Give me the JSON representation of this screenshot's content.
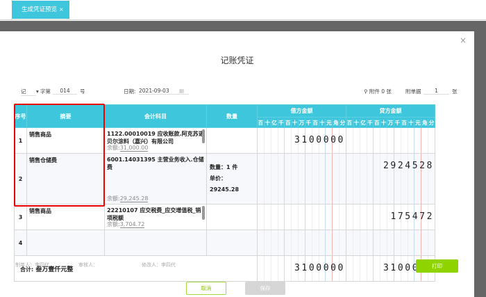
{
  "tab": {
    "label": "生成凭证预览",
    "close": "×"
  },
  "title": "记账凭证",
  "close": "×",
  "meta": {
    "type": "记",
    "zi": "字第",
    "number": "014",
    "hao": "号",
    "date_label": "日期:",
    "date": "2021-09-03",
    "attachment": "附件 0 张",
    "doc_label": "附单据",
    "doc_count": "1",
    "zhang": "张"
  },
  "headers": {
    "seq": "序号",
    "summary": "摘要",
    "account": "会计科目",
    "qty": "数量",
    "debit": "借方金额",
    "credit": "贷方金额",
    "units": [
      "百",
      "十",
      "亿",
      "千",
      "百",
      "十",
      "万",
      "千",
      "百",
      "十",
      "元",
      "角",
      "分"
    ]
  },
  "rows": [
    {
      "seq": "1",
      "summary": "销售商品",
      "account": "1122.00010019 应收账款.阿克苏诺贝尔涂料（嘉兴）有限公司",
      "bal_label": "余额:",
      "balance": "31,000.00",
      "qty": "",
      "price": "",
      "debit": "3100000",
      "credit": ""
    },
    {
      "seq": "2",
      "summary": "销售仓储费",
      "account": "6001.14031395 主营业务收入.仓储费",
      "bal_label": "余额:",
      "balance": "29,245.28",
      "qty": "数量：1 件",
      "price": "单价：29245.28",
      "debit": "",
      "credit": "2924528"
    },
    {
      "seq": "3",
      "summary": "销售商品",
      "account": "22210107 应交税费_应交增值税_销项税额",
      "bal_label": "余额:",
      "balance": "3,704.72",
      "qty": "",
      "price": "",
      "debit": "",
      "credit": "175472"
    },
    {
      "seq": "4",
      "summary": "",
      "account": "",
      "bal_label": "",
      "balance": "",
      "qty": "",
      "price": "",
      "debit": "",
      "credit": ""
    }
  ],
  "total": {
    "label": "合计:",
    "words": "叁万壹仟元整",
    "debit": "3100000",
    "credit": "3100000"
  },
  "footer": {
    "maker": "制单人：李四代",
    "auditor": "审核人：",
    "modifier": "修改人：李四代"
  },
  "buttons": {
    "print": "打印",
    "cancel": "取消",
    "save": "保存"
  },
  "colors": {
    "accent": "#3ec6dc",
    "print": "#8fd400",
    "highlight": "#e00000"
  }
}
